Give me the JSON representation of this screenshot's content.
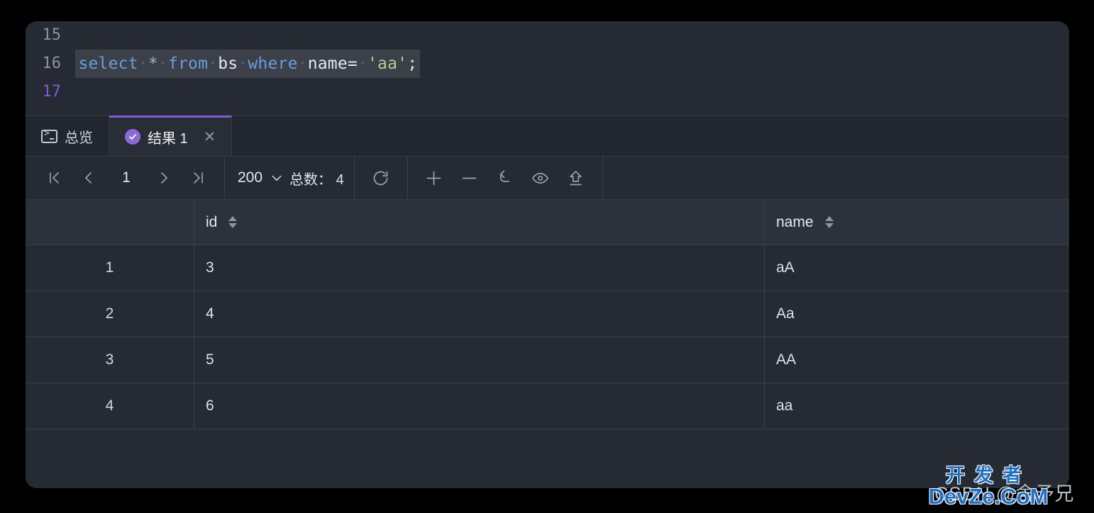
{
  "editor": {
    "lines": [
      {
        "number": "15",
        "active": false,
        "tokens": []
      },
      {
        "number": "16",
        "active": false,
        "tokens": [
          {
            "text": "select",
            "type": "kw"
          },
          {
            "text": "·",
            "type": "dot"
          },
          {
            "text": "*",
            "type": "op"
          },
          {
            "text": "·",
            "type": "dot"
          },
          {
            "text": "from",
            "type": "kw"
          },
          {
            "text": "·",
            "type": "dot"
          },
          {
            "text": "bs",
            "type": "id"
          },
          {
            "text": "·",
            "type": "dot"
          },
          {
            "text": "where",
            "type": "kw"
          },
          {
            "text": "·",
            "type": "dot"
          },
          {
            "text": "name=",
            "type": "id"
          },
          {
            "text": "·",
            "type": "dot"
          },
          {
            "text": "'aa'",
            "type": "str"
          },
          {
            "text": ";",
            "type": "punc"
          }
        ]
      },
      {
        "number": "17",
        "active": true,
        "tokens": []
      }
    ],
    "line15_number": "15",
    "line16_number": "16",
    "line17_number": "17",
    "sql_plain": "select * from bs where name= 'aa';"
  },
  "tabs": [
    {
      "label": "总览",
      "icon": "terminal-icon",
      "active": false,
      "closable": false
    },
    {
      "label": "结果 1",
      "icon": "check-circle-icon",
      "active": true,
      "closable": true,
      "close_label": "✕"
    }
  ],
  "toolbar": {
    "first_page_icon": "first-page-icon",
    "prev_page_icon": "prev-page-icon",
    "page_value": "1",
    "next_page_icon": "next-page-icon",
    "last_page_icon": "last-page-icon",
    "page_size": "200",
    "page_size_caret": "chevron-down-icon",
    "total_label": "总数：",
    "total_value": "4",
    "total_text": "总数： 4",
    "actions": [
      {
        "name": "refresh-icon",
        "title": "refresh"
      },
      {
        "name": "add-row-icon",
        "title": "add"
      },
      {
        "name": "delete-row-icon",
        "title": "delete"
      },
      {
        "name": "undo-icon",
        "title": "undo"
      },
      {
        "name": "preview-icon",
        "title": "preview"
      },
      {
        "name": "submit-icon",
        "title": "submit"
      }
    ]
  },
  "grid": {
    "columns": [
      {
        "key": "rownum",
        "label": "",
        "sortable": false
      },
      {
        "key": "id",
        "label": "id",
        "sortable": true
      },
      {
        "key": "name",
        "label": "name",
        "sortable": true
      }
    ],
    "rows": [
      {
        "rownum": "1",
        "id": "3",
        "name": "aA"
      },
      {
        "rownum": "2",
        "id": "4",
        "name": "Aa"
      },
      {
        "rownum": "3",
        "id": "5",
        "name": "AA"
      },
      {
        "rownum": "4",
        "id": "6",
        "name": "aa"
      }
    ]
  },
  "watermarks": {
    "csdn": "CSDN @舍予兄",
    "devze_cn": "开发者",
    "devze_en": "DevZe.CoM"
  },
  "colors": {
    "panel_bg": "#262a33",
    "tabbar_bg": "#22262e",
    "accent_purple": "#7e5bd6",
    "header_bg": "#2c323c",
    "border": "#3a404b",
    "keyword_blue": "#6c9ce0",
    "string_green": "#b5cc8e",
    "text_primary": "#dde2ea",
    "watermark_blue": "#1f6fc4"
  }
}
